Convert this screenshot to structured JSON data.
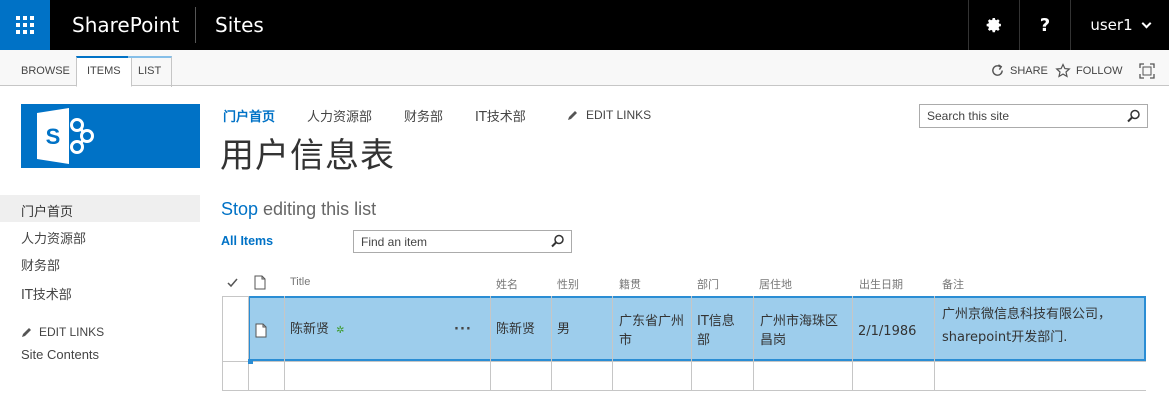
{
  "suitebar": {
    "brand": "SharePoint",
    "app": "Sites",
    "settings_label": "⚙",
    "help_label": "?",
    "user": "user1"
  },
  "ribbon": {
    "tabs": [
      "BROWSE",
      "ITEMS",
      "LIST"
    ],
    "active_tab": "ITEMS",
    "share": "SHARE",
    "follow": "FOLLOW"
  },
  "topnav": {
    "items": [
      "门户首页",
      "人力资源部",
      "财务部",
      "IT技术部"
    ],
    "edit_links": "EDIT LINKS",
    "search_placeholder": "Search this site"
  },
  "page": {
    "title": "用户信息表",
    "stop": "Stop",
    "editing": " editing this list",
    "view": "All Items",
    "find_placeholder": "Find an item"
  },
  "leftnav": {
    "items": [
      "门户首页",
      "人力资源部",
      "财务部",
      "IT技术部"
    ],
    "edit_links": "EDIT LINKS",
    "site_contents": "Site Contents"
  },
  "list": {
    "columns": [
      "Title",
      "姓名",
      "性别",
      "籍贯",
      "部门",
      "居住地",
      "出生日期",
      "备注"
    ],
    "rows": [
      {
        "title": "陈新贤",
        "name": "陈新贤",
        "gender": "男",
        "origin_1": "广东省广州",
        "origin_2": "市",
        "dept_1": "IT信息",
        "dept_2": "部",
        "residence_1": "广州市海珠区",
        "residence_2": "昌岗",
        "birth": "2/1/1986",
        "note_1": "广州京微信息科技有限公司，",
        "note_2": "sharepoint开发部门."
      }
    ],
    "row_menu": "···"
  },
  "colors": {
    "accent": "#0072c6",
    "row_selected": "#9dcdec",
    "suitebar": "#000000"
  }
}
